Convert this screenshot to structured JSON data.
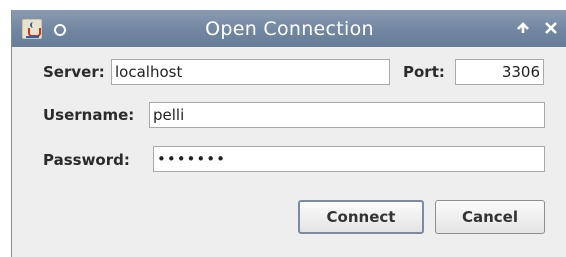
{
  "window": {
    "title": "Open Connection",
    "icons": [
      "java-app-icon",
      "window-menu-icon",
      "maximize-icon",
      "close-icon"
    ],
    "titlebar_color": "#7186a0"
  },
  "form": {
    "server_label": "Server:",
    "server_value": "localhost",
    "port_label": "Port:",
    "port_value": "3306",
    "username_label": "Username:",
    "username_value": "pelli",
    "password_label": "Password:",
    "password_masked": "•••••••"
  },
  "buttons": {
    "connect_label": "Connect",
    "cancel_label": "Cancel"
  }
}
